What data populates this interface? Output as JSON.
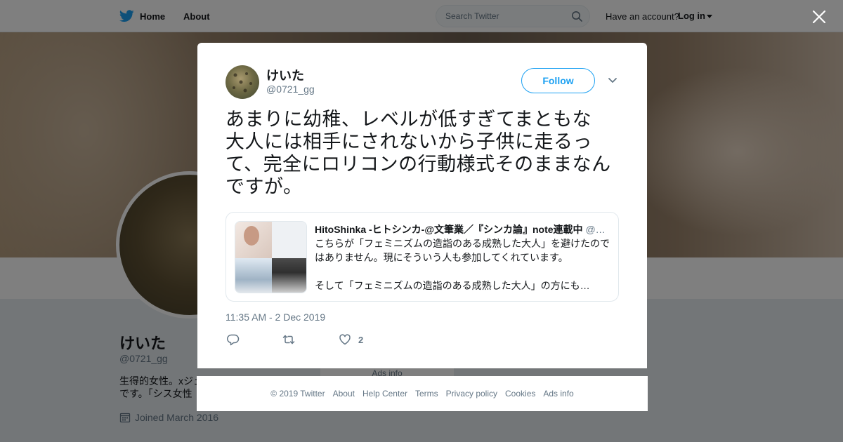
{
  "topbar": {
    "home_label": "Home",
    "about_label": "About",
    "search_placeholder": "Search Twitter",
    "have_account": "Have an account?",
    "login_label": "Log in"
  },
  "profile": {
    "name": "けいた",
    "handle": "@0721_gg",
    "bio_line1": "生得的女性。xジェ",
    "bio_line2": "です。「シス女性",
    "joined": "Joined March 2016",
    "ads_info": "Ads info"
  },
  "tweet": {
    "user_name": "けいた",
    "user_handle": "@0721_gg",
    "follow_label": "Follow",
    "text_lines": [
      "あまりに幼稚、レベルが低すぎてまともな",
      "大人には相手にされないから子供に走るっ",
      "て、完全にロリコンの行動様式そのままなん",
      "ですが。"
    ],
    "quote": {
      "author_name": "HitoShinka -ヒトシンカ-@文筆業／『シンカ論』note連載中",
      "author_handle": "@…",
      "line1": "こちらが「フェミニズムの造詣のある成熟した大人」を避けたので",
      "line2": "はありません。現にそういう人も参加してくれています。",
      "line3": "そして「フェミニズムの造詣のある成熟した大人」の方にも…"
    },
    "timestamp": "11:35 AM - 2 Dec 2019",
    "like_count": "2"
  },
  "footer": {
    "links": [
      "© 2019 Twitter",
      "About",
      "Help Center",
      "Terms",
      "Privacy policy",
      "Cookies",
      "Ads info"
    ]
  },
  "colors": {
    "accent": "#1da1f2",
    "secondary_text": "#657786",
    "overlay": "rgba(0,0,0,0.5)"
  }
}
